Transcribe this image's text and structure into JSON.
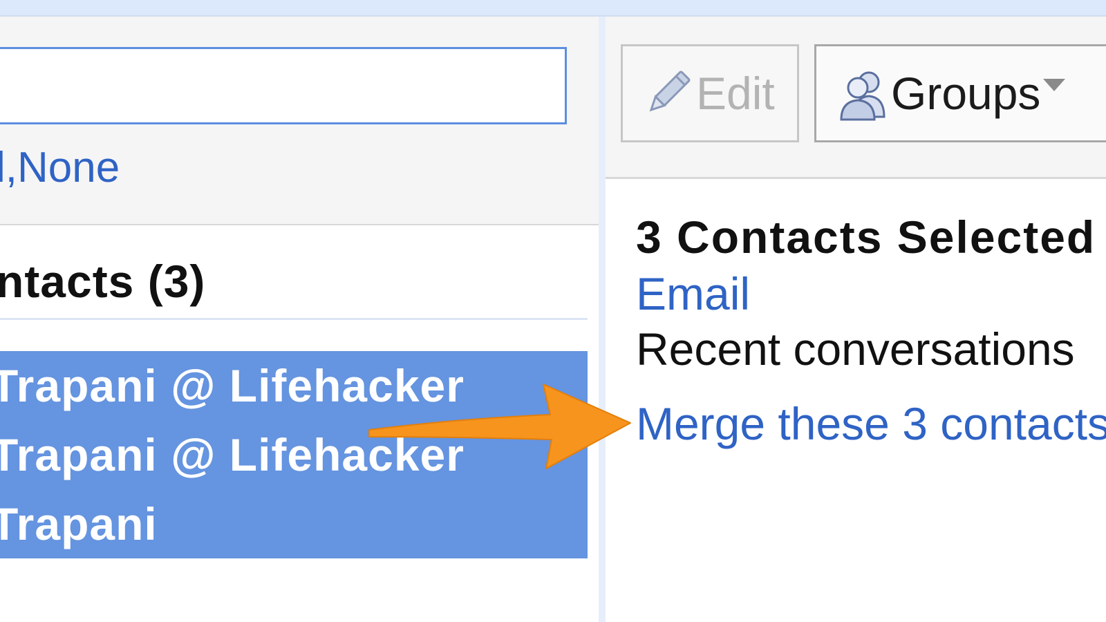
{
  "left_panel": {
    "select_links": {
      "partial_all": "l",
      "separator": ",",
      "none": "None"
    },
    "list_heading": "ntacts (3)",
    "selected_contacts": [
      "Trapani @ Lifehacker",
      "Trapani @ Lifehacker",
      "Trapani"
    ]
  },
  "toolbar": {
    "edit_label": "Edit",
    "groups_label": "Groups"
  },
  "selection_panel": {
    "title": "3 Contacts Selected",
    "email_link": "Email",
    "recent_text": "Recent conversations",
    "merge_link": "Merge these 3 contacts"
  },
  "icons": {
    "edit": "pencil-icon",
    "groups": "people-icon",
    "dropdown": "chevron-down-icon",
    "annotation": "arrow-right-icon"
  },
  "colors": {
    "link": "#2f63c5",
    "selection_bg": "#6594e0",
    "search_border": "#5c8ee0",
    "annotation_arrow": "#f7941d"
  }
}
